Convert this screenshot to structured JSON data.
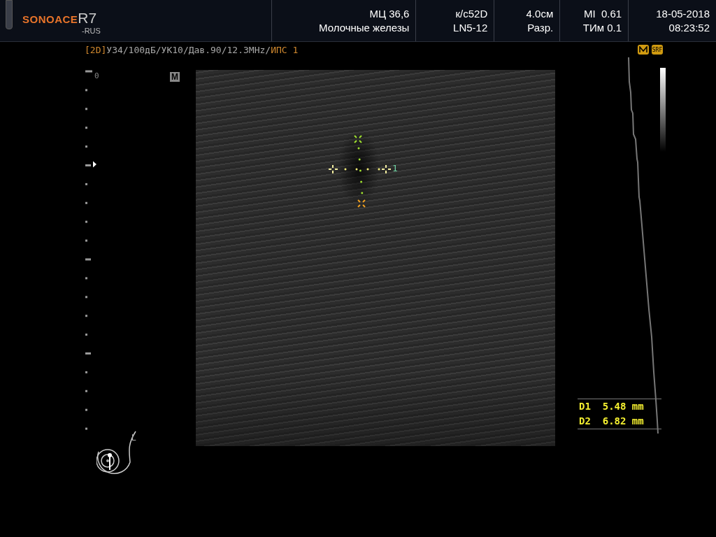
{
  "header": {
    "logo": {
      "brand": "SONOACE",
      "model": "R7",
      "variant": "-RUS"
    },
    "blocks": [
      {
        "top": "МЦ 36,6",
        "bottom": "Молочные железы"
      },
      {
        "top": "к/с52D",
        "bottom": "LN5-12"
      },
      {
        "top": "4.0см",
        "bottom": "Разр."
      },
      {
        "top": "MI  0.61",
        "bottom": "ТИм 0.1"
      },
      {
        "top": "18-05-2018",
        "bottom": "08:23:52"
      }
    ]
  },
  "status_line": {
    "mode": "[2D]",
    "params": "УЗ4/100дБ/УК10/Дав.90/12.3MHz/",
    "tail": "ИПС 1",
    "badge": "SRF"
  },
  "depth_scale": {
    "zero_label": "0"
  },
  "image": {
    "mode_label": "M",
    "marker_label": "1"
  },
  "probe": {
    "side_label": "L"
  },
  "measurements": [
    {
      "label": "D1",
      "value": "5.48 mm"
    },
    {
      "label": "D2",
      "value": "6.82 mm"
    }
  ]
}
